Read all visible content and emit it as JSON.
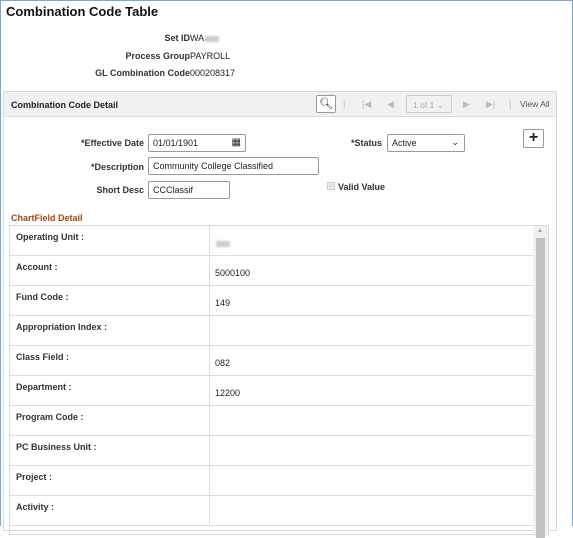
{
  "title": "Combination Code Table",
  "header": {
    "set_id_label": "Set ID",
    "set_id_value": "WA",
    "process_group_label": "Process Group",
    "process_group_value": "PAYROLL",
    "gl_code_label": "GL Combination Code",
    "gl_code_value": "000208317"
  },
  "detail": {
    "title": "Combination Code Detail",
    "pager": "1 of 1",
    "view_all": "View All",
    "effective_date_label": "*Effective Date",
    "effective_date": "01/01/1901",
    "status_label": "*Status",
    "status": "Active",
    "description_label": "*Description",
    "description": "Community College Classified",
    "short_desc_label": "Short Desc",
    "short_desc": "CCClassif",
    "valid_value_label": "Valid Value",
    "valid_value_checked": true
  },
  "chartfield": {
    "title": "ChartField Detail",
    "rows": [
      {
        "label": "Operating Unit :",
        "value": ""
      },
      {
        "label": "Account :",
        "value": "5000100"
      },
      {
        "label": "Fund Code :",
        "value": "149"
      },
      {
        "label": "Appropriation Index :",
        "value": ""
      },
      {
        "label": "Class Field :",
        "value": "082"
      },
      {
        "label": "Department :",
        "value": "12200"
      },
      {
        "label": "Program Code :",
        "value": ""
      },
      {
        "label": "PC Business Unit :",
        "value": ""
      },
      {
        "label": "Project :",
        "value": ""
      },
      {
        "label": "Activity :",
        "value": ""
      }
    ]
  }
}
